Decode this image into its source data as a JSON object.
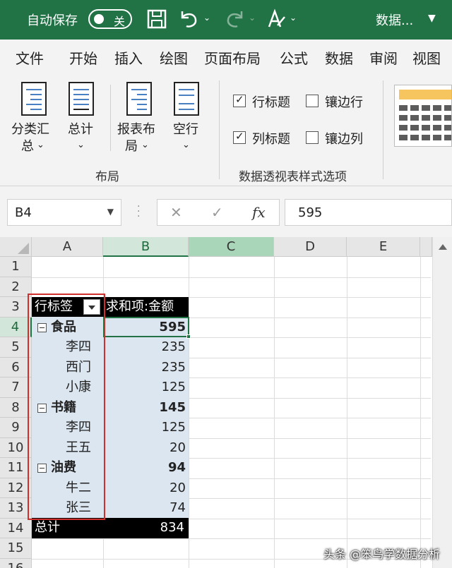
{
  "titlebar": {
    "autosave_label": "自动保存",
    "autosave_state": "关",
    "doc_title": "数据..."
  },
  "menu": [
    "文件",
    "开始",
    "插入",
    "绘图",
    "页面布局",
    "公式",
    "数据",
    "审阅",
    "视图"
  ],
  "ribbon": {
    "layout_group": {
      "label": "布局",
      "buttons": [
        {
          "line1": "分类汇",
          "line2": "总"
        },
        {
          "line1": "总计",
          "line2": ""
        },
        {
          "line1": "报表布",
          "line2": "局"
        },
        {
          "line1": "空行",
          "line2": ""
        }
      ]
    },
    "style_options_group": {
      "label": "数据透视表样式选项",
      "options": [
        {
          "label": "行标题",
          "checked": true
        },
        {
          "label": "镶边行",
          "checked": false
        },
        {
          "label": "列标题",
          "checked": true
        },
        {
          "label": "镶边列",
          "checked": false
        }
      ]
    }
  },
  "formula_bar": {
    "name_box": "B4",
    "fx": "fx",
    "value": "595"
  },
  "columns": [
    "A",
    "B",
    "C",
    "D",
    "E"
  ],
  "rows": [
    "1",
    "2",
    "3",
    "4",
    "5",
    "6",
    "7",
    "8",
    "9",
    "10",
    "11",
    "12",
    "13",
    "14",
    "15",
    "16"
  ],
  "pivot": {
    "row_header": "行标签",
    "value_header": "求和项:金额",
    "rows": [
      {
        "label": "食品",
        "value": "595",
        "group": true
      },
      {
        "label": "李四",
        "value": "235",
        "group": false
      },
      {
        "label": "西门",
        "value": "235",
        "group": false
      },
      {
        "label": "小康",
        "value": "125",
        "group": false
      },
      {
        "label": "书籍",
        "value": "145",
        "group": true
      },
      {
        "label": "李四",
        "value": "125",
        "group": false
      },
      {
        "label": "王五",
        "value": "20",
        "group": false
      },
      {
        "label": "油费",
        "value": "94",
        "group": true
      },
      {
        "label": "牛二",
        "value": "20",
        "group": false
      },
      {
        "label": "张三",
        "value": "74",
        "group": false
      }
    ],
    "total_label": "总计",
    "total_value": "834"
  },
  "watermark": "头条 @笨鸟学数据分析"
}
